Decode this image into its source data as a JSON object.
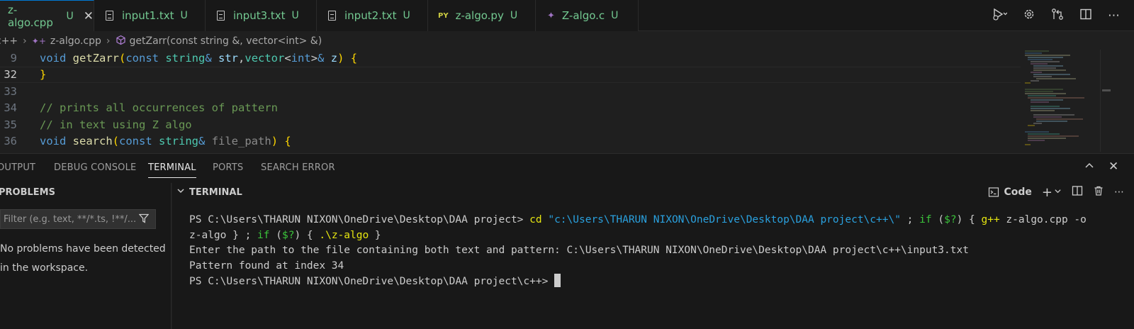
{
  "tabs": [
    {
      "label": "z-algo.cpp",
      "status": "U",
      "icon": "cpp-file-icon",
      "active": true
    },
    {
      "label": "input1.txt",
      "status": "U",
      "icon": "text-file-icon"
    },
    {
      "label": "input3.txt",
      "status": "U",
      "icon": "text-file-icon"
    },
    {
      "label": "input2.txt",
      "status": "U",
      "icon": "text-file-icon"
    },
    {
      "label": "z-algo.py",
      "status": "U",
      "icon": "python-file-icon",
      "icon_text": "PY"
    },
    {
      "label": "Z-algo.c",
      "status": "U",
      "icon": "c-file-icon"
    }
  ],
  "toolbar_icons": [
    "run-debug-icon",
    "chevron-down-icon",
    "settings-gear-icon",
    "source-control-compare-icon",
    "split-editor-icon",
    "more-actions-icon"
  ],
  "breadcrumb": {
    "folder": "c++",
    "file": "z-algo.cpp",
    "symbol": "getZarr(const string &, vector<int> &)"
  },
  "editor": {
    "lines": [
      {
        "num": "9",
        "tokens": [
          [
            "k",
            "void "
          ],
          [
            "f",
            "getZarr"
          ],
          [
            "b1",
            "("
          ],
          [
            "k",
            "const "
          ],
          [
            "t",
            "string"
          ],
          [
            "k",
            "& "
          ],
          [
            "p",
            "str"
          ],
          [
            "",
            ","
          ],
          [
            "t",
            "vector"
          ],
          [
            "",
            "<"
          ],
          [
            "k",
            "int"
          ],
          [
            "",
            ">"
          ],
          [
            "k",
            "& "
          ],
          [
            "p",
            "z"
          ],
          [
            "b1",
            ")"
          ],
          [
            "",
            " "
          ],
          [
            "b1",
            "{"
          ]
        ]
      },
      {
        "num": "32",
        "tokens": [
          [
            "b1",
            "}"
          ]
        ],
        "current": true
      },
      {
        "num": "33",
        "tokens": []
      },
      {
        "num": "34",
        "tokens": [
          [
            "c",
            "// prints all occurrences of pattern"
          ]
        ]
      },
      {
        "num": "35",
        "tokens": [
          [
            "c",
            "// in text using Z algo"
          ]
        ]
      },
      {
        "num": "36",
        "tokens": [
          [
            "k",
            "void "
          ],
          [
            "f",
            "search"
          ],
          [
            "b1",
            "("
          ],
          [
            "k",
            "const "
          ],
          [
            "t",
            "string"
          ],
          [
            "k",
            "& "
          ],
          [
            "pd",
            "file_path"
          ],
          [
            "b1",
            ")"
          ],
          [
            "",
            " "
          ],
          [
            "b1",
            "{"
          ]
        ]
      }
    ]
  },
  "panel": {
    "tabs": [
      "OUTPUT",
      "DEBUG CONSOLE",
      "TERMINAL",
      "PORTS",
      "SEARCH ERROR"
    ],
    "active_tab": "TERMINAL",
    "problems": {
      "title": "PROBLEMS",
      "filter_placeholder": "Filter (e.g. text, **/*.ts, !**/...",
      "message": "No problems have been detected in the workspace."
    },
    "terminal": {
      "title": "TERMINAL",
      "profile": "Code",
      "lines": [
        [
          [
            "",
            "PS C:\\Users\\THARUN NIXON\\OneDrive\\Desktop\\DAA project> "
          ],
          [
            "y",
            "cd "
          ],
          [
            "sb",
            "\"c:\\Users\\THARUN NIXON\\OneDrive\\Desktop\\DAA project\\c++\\\""
          ],
          [
            "",
            " ; "
          ],
          [
            "gr",
            "if "
          ],
          [
            "",
            "("
          ],
          [
            "gr",
            "$?"
          ],
          [
            "",
            ") { "
          ],
          [
            "y",
            "g++ "
          ],
          [
            "",
            "z-algo.cpp -o"
          ]
        ],
        [
          [
            "",
            "z-algo } ; "
          ],
          [
            "gr",
            "if "
          ],
          [
            "",
            "("
          ],
          [
            "gr",
            "$?"
          ],
          [
            "",
            ") { "
          ],
          [
            "y",
            ".\\z-algo"
          ],
          [
            "",
            " }"
          ]
        ],
        [
          [
            "",
            "Enter the path to the file containing both text and pattern: C:\\Users\\THARUN NIXON\\OneDrive\\Desktop\\DAA project\\c++\\input3.txt"
          ]
        ],
        [
          [
            "",
            "Pattern found at index 34"
          ]
        ],
        [
          [
            "",
            "PS C:\\Users\\THARUN NIXON\\OneDrive\\Desktop\\DAA project\\c++> "
          ]
        ]
      ]
    }
  }
}
